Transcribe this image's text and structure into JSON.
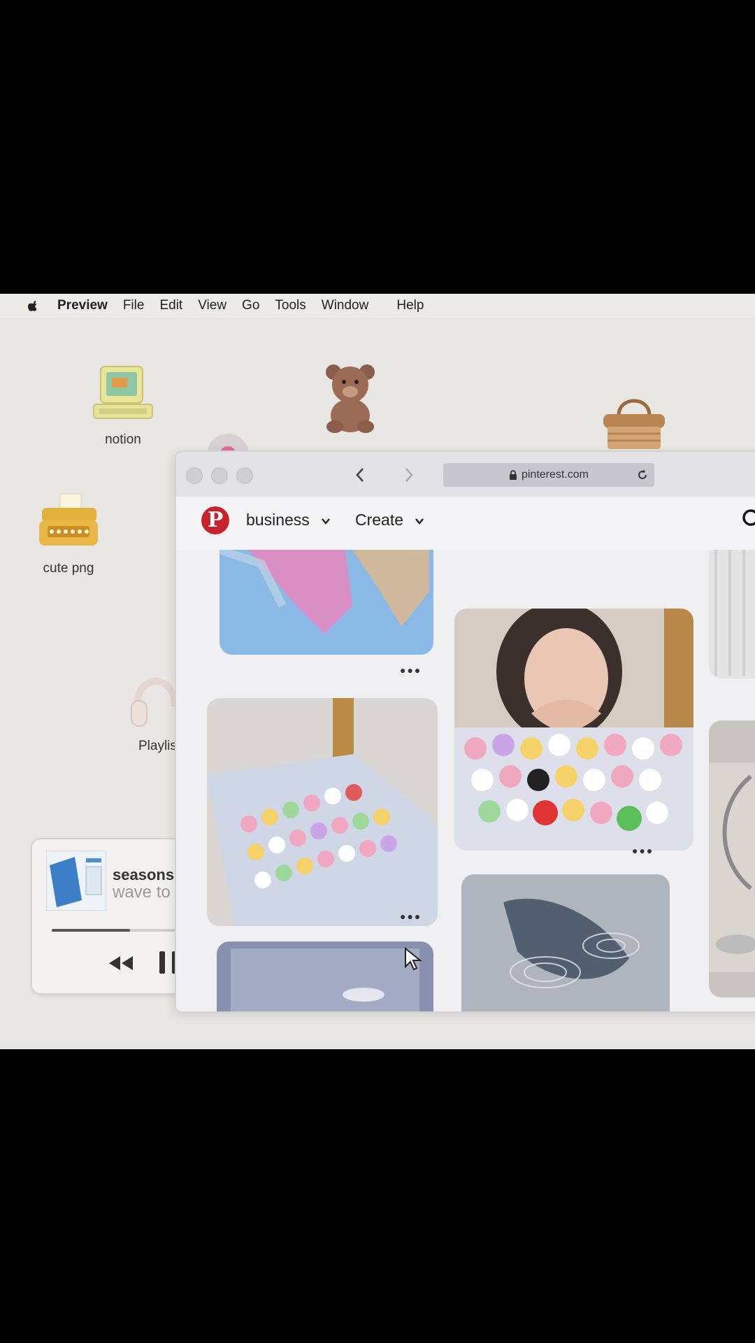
{
  "menubar": {
    "app_name": "Preview",
    "items": [
      "File",
      "Edit",
      "View",
      "Go",
      "Tools",
      "Window",
      "Help"
    ]
  },
  "desktop": {
    "icons": [
      {
        "label": "notion",
        "icon": "retro-computer-icon"
      },
      {
        "label": "cute png",
        "icon": "typewriter-icon"
      },
      {
        "label": "Playlis",
        "icon": "headphones-icon"
      }
    ]
  },
  "music": {
    "title": "seasons",
    "artist": "wave to",
    "progress": 0.43
  },
  "browser": {
    "url": "pinterest.com",
    "nav": {
      "account": "business",
      "create": "Create"
    }
  },
  "colors": {
    "pinterest_red": "#c8232c",
    "desktop_bg": "#e9e7e3"
  }
}
